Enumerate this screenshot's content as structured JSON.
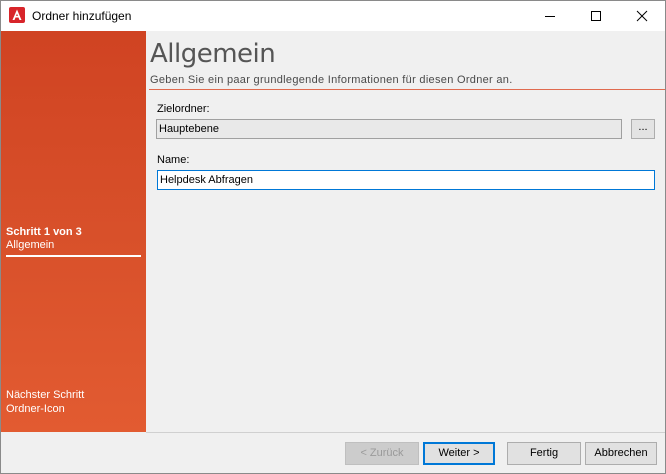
{
  "window": {
    "title": "Ordner hinzufügen"
  },
  "header": {
    "title": "Allgemein",
    "subtitle": "Geben Sie ein paar grundlegende Informationen für diesen Ordner an."
  },
  "sidebar": {
    "current_step_label": "Schritt 1 von 3",
    "current_step_name": "Allgemein",
    "next_step_label": "Nächster Schritt",
    "next_step_name": "Ordner-Icon"
  },
  "form": {
    "target_label": "Zielordner:",
    "target_value": "Hauptebene",
    "browse_label": "...",
    "name_label": "Name:",
    "name_value": "Helpdesk Abfragen"
  },
  "buttons": {
    "back": "< Zurück",
    "next": "Weiter >",
    "finish": "Fertig",
    "cancel": "Abbrechen"
  },
  "colors": {
    "sidebar_accent": "#d8502a",
    "focus_border": "#0078d7"
  }
}
